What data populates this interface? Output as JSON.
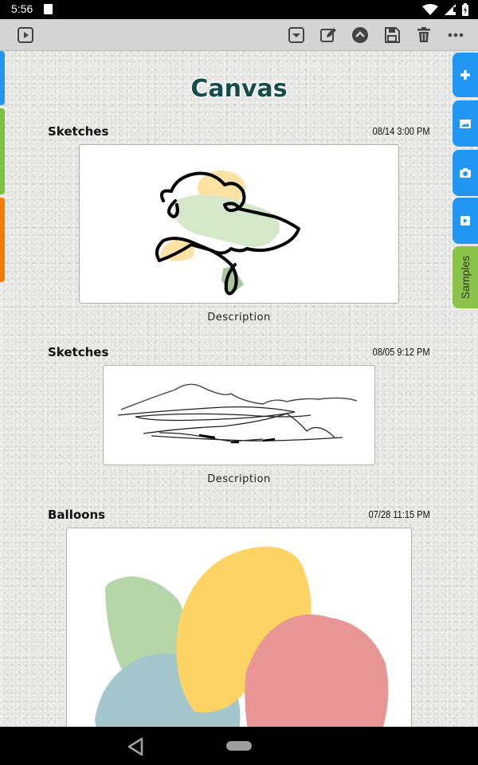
{
  "status_bar": {
    "time": "5:56"
  },
  "page": {
    "title": "Canvas"
  },
  "entries": [
    {
      "title": "Sketches",
      "date": "08/14  3:00 PM",
      "description": "Description"
    },
    {
      "title": "Sketches",
      "date": "08/05  9:12 PM",
      "description": "Description"
    },
    {
      "title": "Balloons",
      "date": "07/28 11:15 PM"
    }
  ],
  "right_tabs": {
    "samples_label": "Samples"
  },
  "colors": {
    "accent_blue": "#2196f3",
    "samples_green": "#8bc34a",
    "title_teal": "#144d4a",
    "left_tab_blue": "#2196f3",
    "left_tab_green": "#7cc242",
    "left_tab_orange": "#f57c00"
  },
  "icons": {
    "toolbar_left": "play-square-icon",
    "toolbar_right": [
      "dropdown-square-icon",
      "edit-icon",
      "chevron-up-circle-icon",
      "save-icon",
      "trash-icon",
      "more-icon"
    ],
    "side_tabs": [
      "plus-icon",
      "image-folder-icon",
      "camera-icon",
      "video-icon"
    ]
  }
}
